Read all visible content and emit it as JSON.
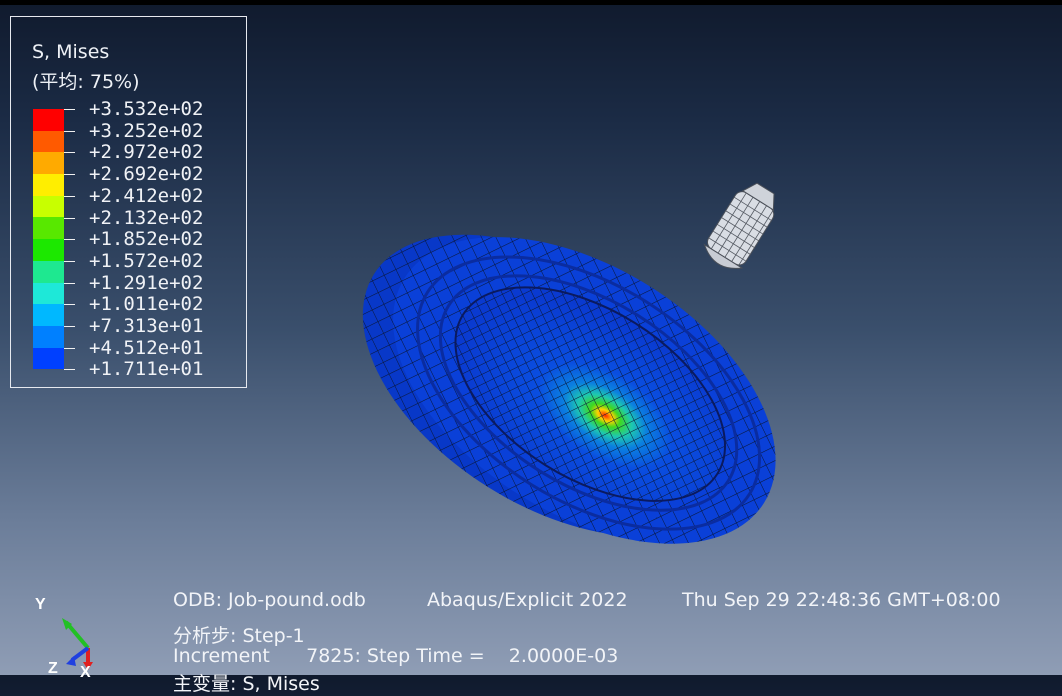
{
  "legend": {
    "title": "S, Mises",
    "subtitle": "(平均: 75%)",
    "values": [
      "+3.532e+02",
      "+3.252e+02",
      "+2.972e+02",
      "+2.692e+02",
      "+2.412e+02",
      "+2.132e+02",
      "+1.852e+02",
      "+1.572e+02",
      "+1.291e+02",
      "+1.011e+02",
      "+7.313e+01",
      "+4.512e+01",
      "+1.711e+01"
    ],
    "colors": [
      "#ff0000",
      "#ff5a00",
      "#ffaa00",
      "#ffee00",
      "#c8ff00",
      "#58e800",
      "#1ce800",
      "#1ee890",
      "#1ee8d8",
      "#00b8ff",
      "#0080ff",
      "#0040ff"
    ]
  },
  "info": {
    "odb": "ODB: Job-pound.odb",
    "solver": "Abaqus/Explicit 2022",
    "datetime": "Thu Sep 29 22:48:36 GMT+08:00",
    "step": "分析步: Step-1",
    "increment": "Increment      7825: Step Time =    2.0000E-03",
    "variable_partial": "主变量: S, Mises"
  },
  "triad": {
    "y": "Y",
    "z": "Z",
    "x": "X"
  }
}
